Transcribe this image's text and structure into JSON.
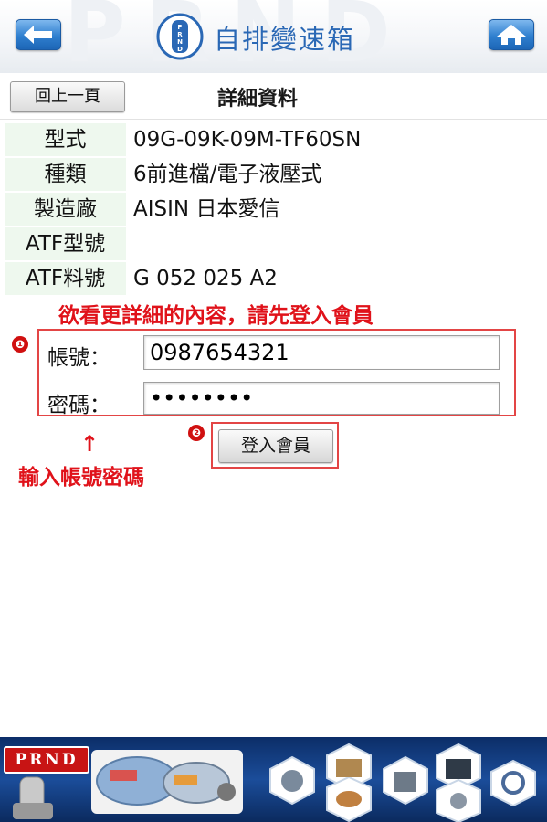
{
  "header": {
    "title": "自排變速箱",
    "watermark": "PRND",
    "logo_text": "PRND"
  },
  "subheader": {
    "back_label": "回上一頁",
    "title": "詳細資料"
  },
  "details": [
    {
      "label": "型式",
      "value": "09G-09K-09M-TF60SN"
    },
    {
      "label": "種類",
      "value": "6前進檔/電子液壓式"
    },
    {
      "label": "製造廠",
      "value": "AISIN 日本愛信"
    },
    {
      "label": "ATF型號",
      "value": ""
    },
    {
      "label": "ATF料號",
      "value": "G 052 025 A2"
    }
  ],
  "login": {
    "notice": "欲看更詳細的內容，請先登入會員",
    "account_label": "帳號：",
    "account_value": "0987654321",
    "password_label": "密碼：",
    "password_value": "••••••••",
    "step1": "❶",
    "step2": "❷",
    "login_button": "登入會員",
    "arrow": "↑",
    "hint": "輸入帳號密碼"
  },
  "banner": {
    "brand": "PRND"
  },
  "colors": {
    "accent_red": "#e0121a",
    "header_blue": "#2a68b5",
    "label_bg": "#eef8ee",
    "banner_blue": "#1b4d9a"
  },
  "icons": [
    "back-arrow-icon",
    "home-icon",
    "prnd-logo-icon",
    "transmission-image"
  ]
}
